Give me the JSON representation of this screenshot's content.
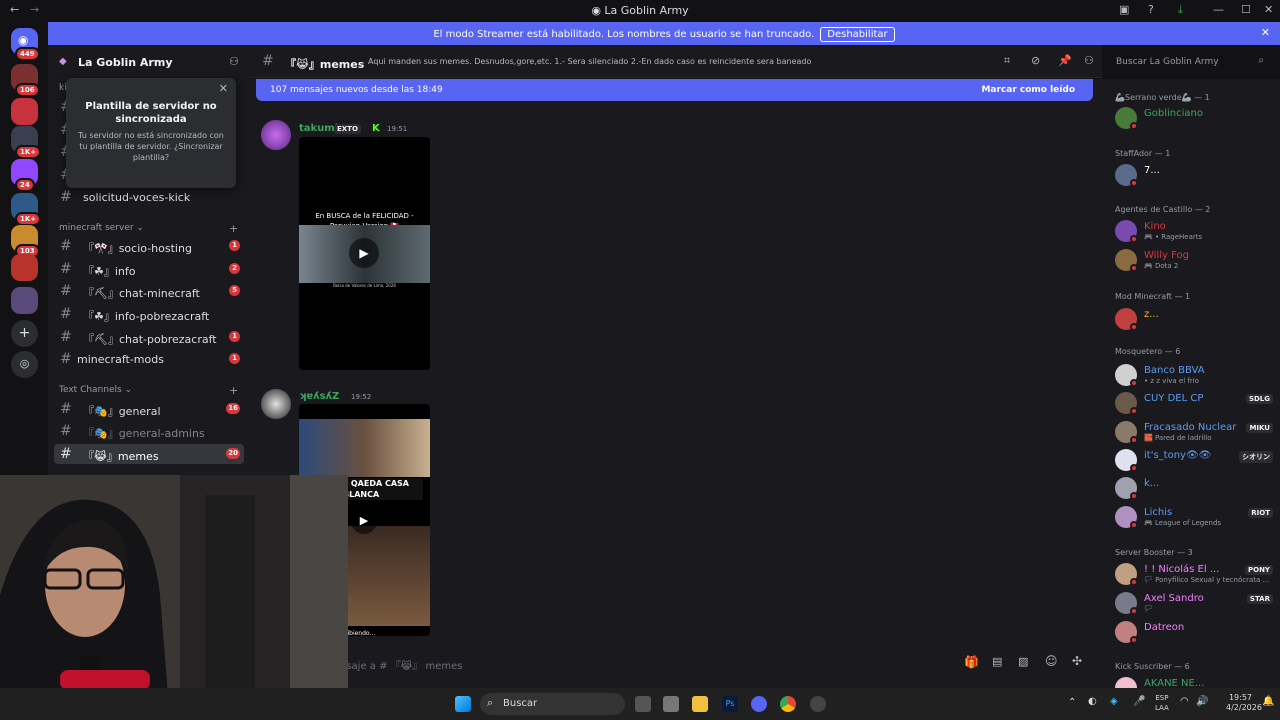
{
  "window": {
    "title": "La Goblin Army"
  },
  "banner": {
    "text": "El modo Streamer está habilitado. Los nombres de usuario se han truncado.",
    "button": "Deshabilitar"
  },
  "servers": [
    {
      "badge": "449"
    },
    {
      "badge": "106"
    },
    {
      "badge": ""
    },
    {
      "badge": "1K+"
    },
    {
      "badge": "24"
    },
    {
      "badge": "1K+"
    },
    {
      "badge": "103"
    },
    {
      "badge": ""
    },
    {
      "badge": ""
    }
  ],
  "guild": {
    "name": "La Goblin Army"
  },
  "popup": {
    "title": "Plantilla de servidor no sincronizada",
    "body": "Tu servidor no está sincronizado con tu plantilla de servidor. ¿Sincronizar plantilla?"
  },
  "sidebar": {
    "top_partial": "kick",
    "channel_solicitud": "solicitud-voces-kick",
    "category_minecraft": "minecraft server",
    "category_text": "Text Channels",
    "minecraft_channels": [
      {
        "label": "『🎌』socio-hosting",
        "count": "1"
      },
      {
        "label": "『☘』info",
        "count": "2"
      },
      {
        "label": "『⛏』chat-minecraft",
        "count": "5"
      },
      {
        "label": "『☘』info-pobrezacraft",
        "count": ""
      },
      {
        "label": "『⛏』chat-pobrezacraft",
        "count": "1"
      },
      {
        "label": "minecraft-mods",
        "count": "1"
      }
    ],
    "text_channels": [
      {
        "label": "『🎭』general",
        "count": "16"
      },
      {
        "label": "『🎭』general-admins",
        "count": ""
      },
      {
        "label": "『😹』memes",
        "count": "20"
      }
    ]
  },
  "channel": {
    "name": "『😹』memes",
    "topic": "Aqui manden sus memes. Desnudos,gore,etc. 1.- Sera silenciado 2.-En dado caso es reincidente sera baneado",
    "search_placeholder": "Buscar La Goblin Army"
  },
  "newbar": {
    "text": "107 mensajes nuevos desde las 18:49",
    "action": "Marcar como leído"
  },
  "messages": [
    {
      "user": "takumi",
      "tag": "EXTO",
      "time": "19:51",
      "video_caption": "En BUSCA de la FELICIDAD - Peruvian Version 🇵🇪",
      "video_sub": "Bolsa de Valores de Lima, 2026"
    },
    {
      "user": "ʞɐʎsʎZ",
      "time": "19:52",
      "video_caption": "L QAEDA CASA BLANCA",
      "video_sub": "ribiendo..."
    }
  ],
  "composer": {
    "placeholder": "nsaje a # 『😹』 memes"
  },
  "members": [
    {
      "group": "🦾Serrano verde🦾 — 1",
      "items": [
        {
          "name": "Goblinciano",
          "sub": "",
          "tag": "",
          "color": "#3ba55d"
        }
      ]
    },
    {
      "group": "StaffAdor — 1",
      "items": [
        {
          "name": "7...",
          "sub": "",
          "tag": "",
          "color": "#f2f3f5"
        }
      ]
    },
    {
      "group": "Agentes de Castillo — 2",
      "items": [
        {
          "name": "Kino",
          "sub": "🎮 • RageHearts",
          "tag": "",
          "color": "#da373c"
        },
        {
          "name": "Willy Fog",
          "sub": "🎮 Dota 2",
          "tag": "",
          "color": "#da373c"
        }
      ]
    },
    {
      "group": "Mod Minecraft — 1",
      "items": [
        {
          "name": "z...",
          "sub": "",
          "tag": "",
          "color": "#f0b232"
        }
      ]
    },
    {
      "group": "Mosquetero — 6",
      "items": [
        {
          "name": "Banco BBVA",
          "sub": "• z z viva el frio",
          "tag": "",
          "color": "#5b9bf0"
        },
        {
          "name": "CUY DEL CP",
          "sub": "",
          "tag": "SDLG",
          "color": "#5b9bf0"
        },
        {
          "name": "Fracasado Nuclear",
          "sub": "🧱 Pared de ladrillo",
          "tag": "MIKU",
          "color": "#5b9bf0"
        },
        {
          "name": "it's_tony👁👁",
          "sub": "",
          "tag": "シオリン",
          "color": "#5b9bf0"
        },
        {
          "name": "k...",
          "sub": "",
          "tag": "",
          "color": "#5b9bf0"
        },
        {
          "name": "Lichis",
          "sub": "🎮 League of Legends",
          "tag": "RIOT",
          "color": "#5b9bf0"
        }
      ]
    },
    {
      "group": "Server Booster — 3",
      "items": [
        {
          "name": "! ! Nicolás El ...",
          "sub": "🏳 Ponyfilico Sexual y tecnócrata ...",
          "tag": "PONY",
          "color": "#f47fff"
        },
        {
          "name": "Axel Sandro",
          "sub": "🏳",
          "tag": "STAR",
          "color": "#f47fff"
        },
        {
          "name": "Datreon",
          "sub": "",
          "tag": "",
          "color": "#f47fff"
        }
      ]
    },
    {
      "group": "Kick Suscriber — 6",
      "items": [
        {
          "name": "AKANE NE...",
          "sub": "",
          "tag": "",
          "color": "#3ba55d"
        }
      ]
    }
  ],
  "taskbar": {
    "search": "Buscar",
    "lang": "ESP",
    "lang2": "LAA",
    "time": "19:57",
    "date": "4/2/2026"
  },
  "colors": {
    "accent": "#5865f2",
    "danger": "#da373c",
    "bg": "#1a1a1e",
    "rail": "#121214"
  }
}
